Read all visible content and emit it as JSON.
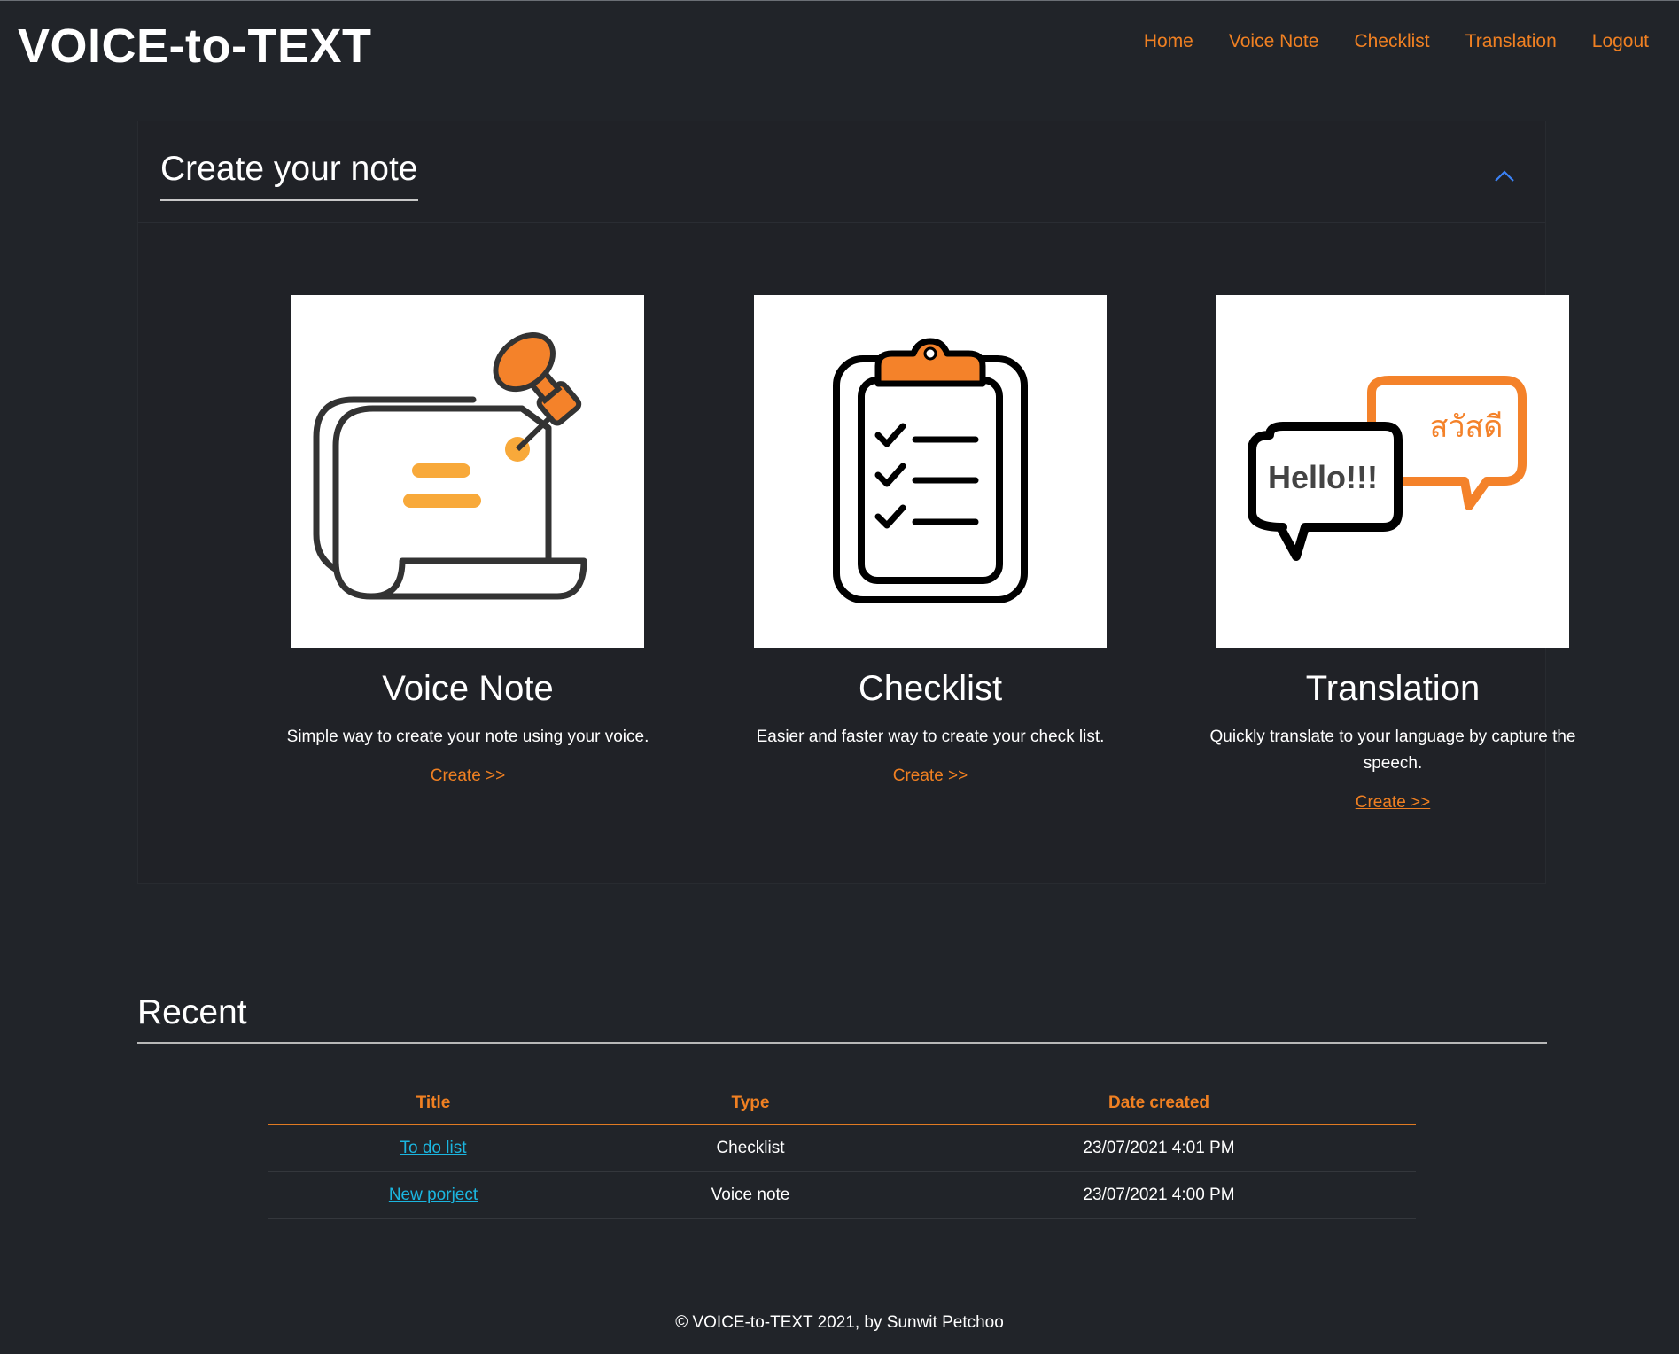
{
  "navbar": {
    "brand": "VOICE-to-TEXT",
    "links": [
      "Home",
      "Voice Note",
      "Checklist",
      "Translation",
      "Logout"
    ]
  },
  "create_panel": {
    "title": "Create your note",
    "cards": [
      {
        "image": "pinned-note-icon",
        "title": "Voice Note",
        "description": "Simple way to create your note using your voice.",
        "link": "Create >>"
      },
      {
        "image": "clipboard-checklist-icon",
        "title": "Checklist",
        "description": "Easier and faster way to create your check list.",
        "link": "Create >>"
      },
      {
        "image": "speech-bubbles-translate-icon",
        "image_text": [
          "Hello!!!",
          "สวัสดี"
        ],
        "title": "Translation",
        "description": "Quickly translate to your language by capture the speech.",
        "link": "Create >>"
      }
    ]
  },
  "recent": {
    "title": "Recent",
    "columns": [
      "Title",
      "Type",
      "Date created"
    ],
    "rows": [
      {
        "title": "To do list",
        "type": "Checklist",
        "date": "23/07/2021 4:01 PM"
      },
      {
        "title": "New porject",
        "type": "Voice note",
        "date": "23/07/2021 4:00 PM"
      }
    ]
  },
  "footer": "© VOICE-to-TEXT 2021, by Sunwit Petchoo",
  "colors": {
    "background": "#212429",
    "accent": "#f08022",
    "link": "#1bb6e0",
    "icon_orange": "#f4822a",
    "icon_yellow": "#f8a93a"
  }
}
